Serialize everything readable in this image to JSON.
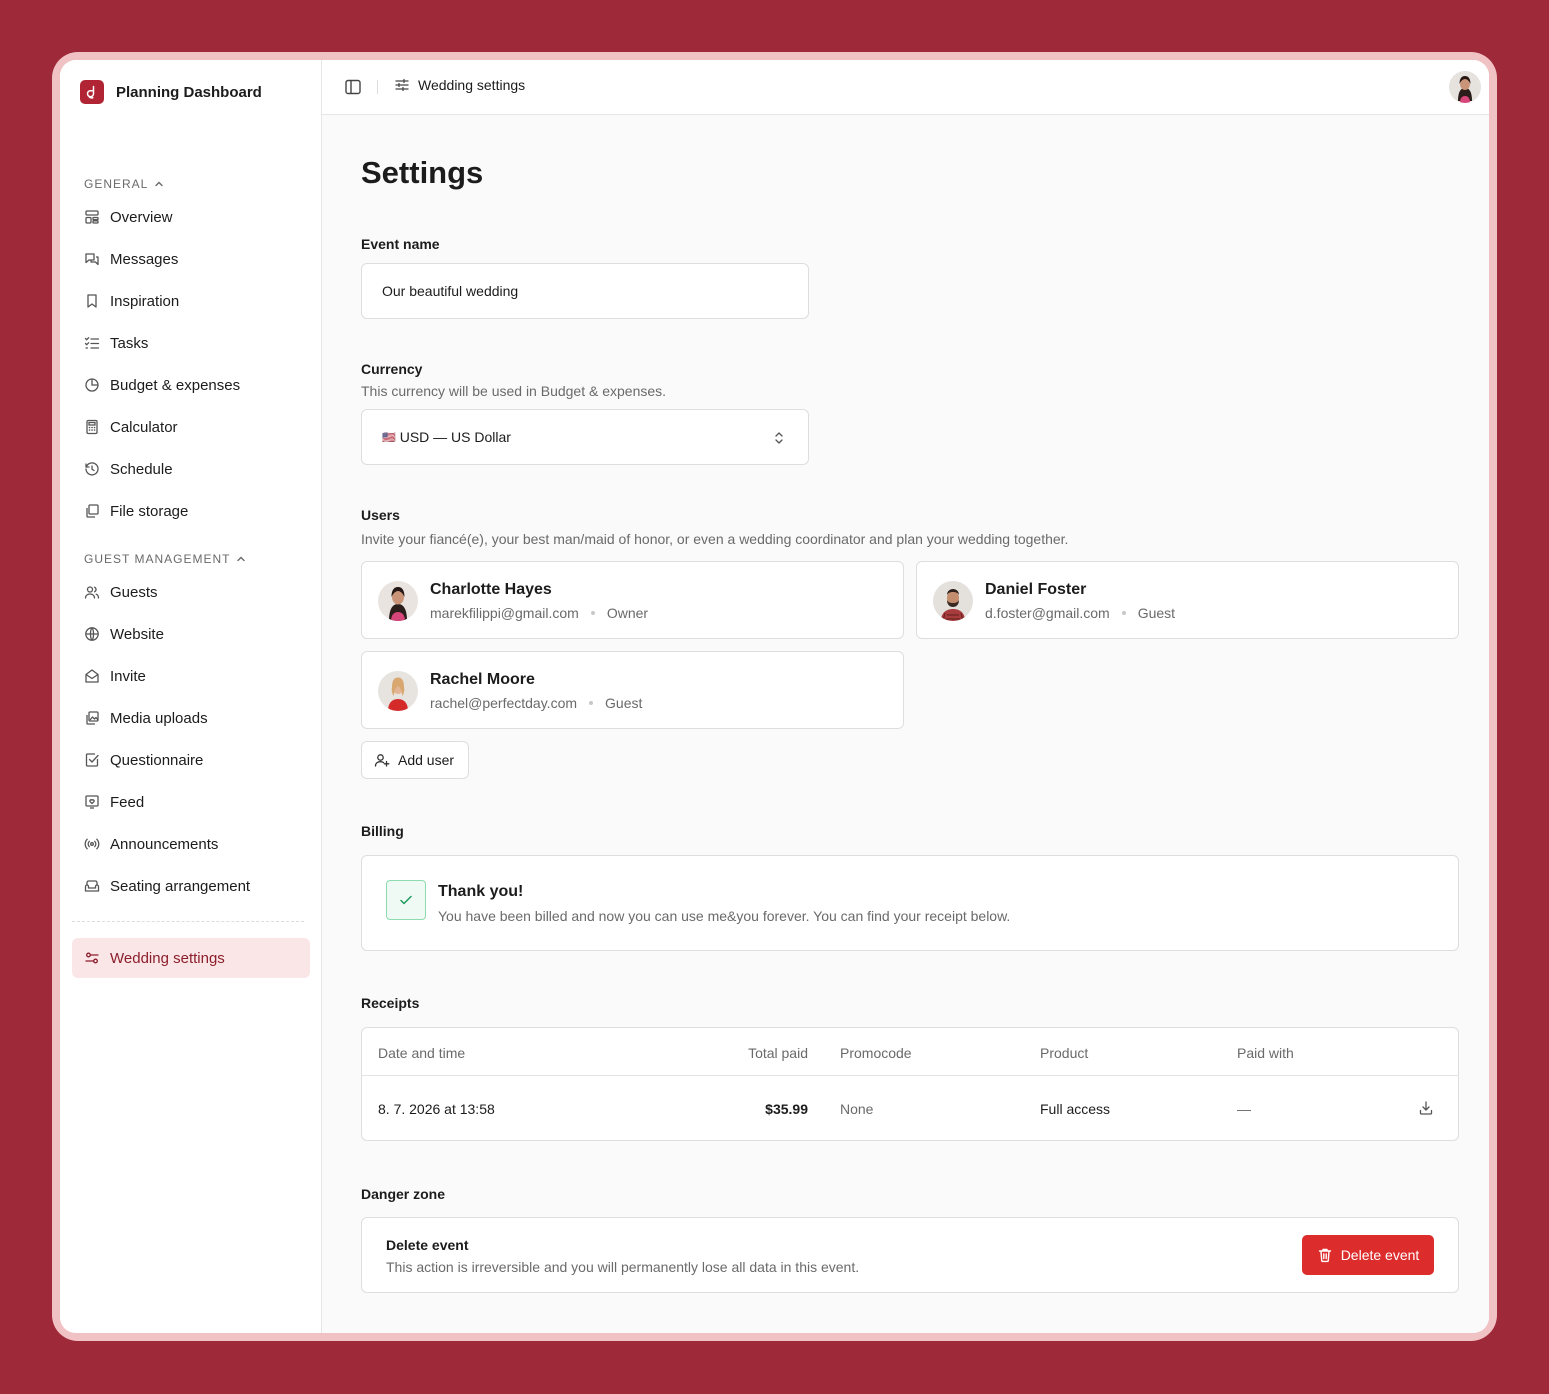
{
  "app": {
    "title": "Planning Dashboard"
  },
  "topbar": {
    "breadcrumb": "Wedding settings"
  },
  "sidebar": {
    "sections": [
      {
        "label": "GENERAL",
        "items": [
          "Overview",
          "Messages",
          "Inspiration",
          "Tasks",
          "Budget & expenses",
          "Calculator",
          "Schedule",
          "File storage"
        ]
      },
      {
        "label": "GUEST MANAGEMENT",
        "items": [
          "Guests",
          "Website",
          "Invite",
          "Media uploads",
          "Questionnaire",
          "Feed",
          "Announcements",
          "Seating arrangement"
        ]
      }
    ],
    "active_item": "Wedding settings"
  },
  "page": {
    "title": "Settings"
  },
  "event": {
    "label": "Event name",
    "value": "Our beautiful wedding"
  },
  "currency": {
    "label": "Currency",
    "description": "This currency will be used in Budget & expenses.",
    "value": "USD — US Dollar",
    "flag": "🇺🇸"
  },
  "users": {
    "label": "Users",
    "description": "Invite your fiancé(e), your best man/maid of honor, or even a wedding coordinator and plan your wedding together.",
    "list": [
      {
        "name": "Charlotte Hayes",
        "email": "marekfilippi@gmail.com",
        "role": "Owner"
      },
      {
        "name": "Daniel Foster",
        "email": "d.foster@gmail.com",
        "role": "Guest"
      },
      {
        "name": "Rachel Moore",
        "email": "rachel@perfectday.com",
        "role": "Guest"
      }
    ],
    "add_label": "Add user"
  },
  "billing": {
    "label": "Billing",
    "title": "Thank you!",
    "text": "You have been billed and now you can use me&you forever. You can find your receipt below."
  },
  "receipts": {
    "label": "Receipts",
    "columns": [
      "Date and time",
      "Total paid",
      "Promocode",
      "Product",
      "Paid with"
    ],
    "rows": [
      {
        "date": "8. 7. 2026 at 13:58",
        "total": "$35.99",
        "promocode": "None",
        "product": "Full access",
        "paid_with": "—"
      }
    ]
  },
  "danger": {
    "label": "Danger zone",
    "title": "Delete event",
    "text": "This action is irreversible and you will permanently lose all data in this event.",
    "button": "Delete event"
  },
  "colors": {
    "brand": "#B02433",
    "background": "#9E2A39",
    "frame": "#F1C2C4",
    "active_bg": "#FBE6E7",
    "danger": "#DD2C2C",
    "success": "#8DDBB0"
  }
}
